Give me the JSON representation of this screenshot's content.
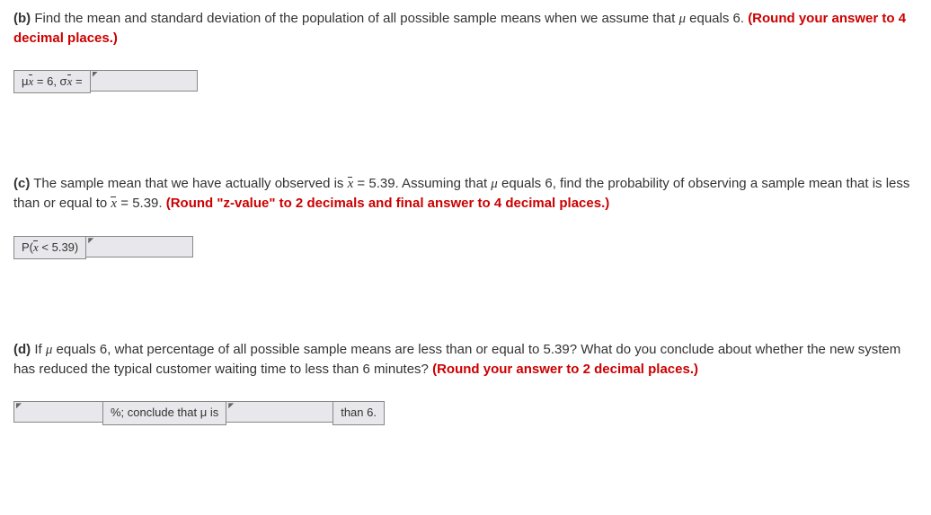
{
  "part_b": {
    "label": "(b)",
    "text_before_mu": " Find the mean and standard deviation of the population of all possible sample means when we assume that ",
    "text_after_mu": " equals 6. ",
    "emphasis": "(Round your answer to 4 decimal places.)",
    "answer_label": "μx̄ = 6, σx̄ ="
  },
  "part_c": {
    "label": "(c)",
    "text_1": " The sample mean that we have actually observed is ",
    "xbar_val_1": " = 5.39. Assuming that ",
    "text_2": " equals 6, find the probability of observing a sample mean that is less than or equal to ",
    "xbar_val_2": " = 5.39. ",
    "emphasis": "(Round \"z-value\" to 2 decimals and final answer to 4 decimal places.)",
    "answer_label": "P(x̄ < 5.39)"
  },
  "part_d": {
    "label": "(d)",
    "text_before_mu": " If ",
    "text_after_mu": " equals 6, what percentage of all possible sample means are less than or equal to 5.39? What do you conclude about whether the new system has reduced the typical customer waiting time to less than 6 minutes? ",
    "emphasis": "(Round your answer to 2 decimal places.)",
    "mid_label_1": "%; conclude that μ is",
    "mid_label_2": "than 6."
  }
}
